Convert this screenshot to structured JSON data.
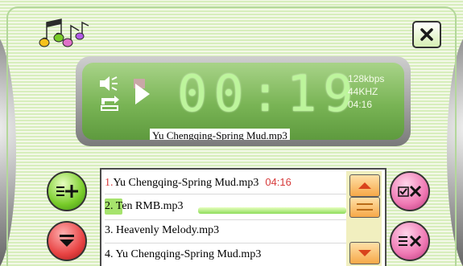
{
  "display": {
    "time": "00:19",
    "bitrate": "128kbps",
    "samplerate": "44KHZ",
    "duration": "04:16",
    "now_playing": "Yu Chengqing-Spring Mud.mp3"
  },
  "playlist": {
    "items": [
      {
        "index": "1.",
        "title": "Yu Chengqing-Spring Mud.mp3",
        "duration": "04:16"
      },
      {
        "index": "2.",
        "title": "Ten RMB.mp3"
      },
      {
        "index": "3.",
        "title": "Heavenly Melody.mp3"
      },
      {
        "index": "4.",
        "title": "Yu Chengqing-Spring Mud.mp3"
      }
    ]
  },
  "icons": {
    "logo": "music-notes-icon",
    "close": "close-icon",
    "speaker": "speaker-icon",
    "repeat": "repeat-icon",
    "play": "play-icon",
    "add": "add-to-playlist-icon",
    "collapse": "collapse-icon",
    "delete_checked": "delete-checked-icon",
    "clear": "clear-playlist-icon"
  },
  "colors": {
    "accent_green": "#79b455",
    "time_green": "#bdf59c",
    "highlight_red": "#d63a3a",
    "pink": "#ee77b2"
  }
}
